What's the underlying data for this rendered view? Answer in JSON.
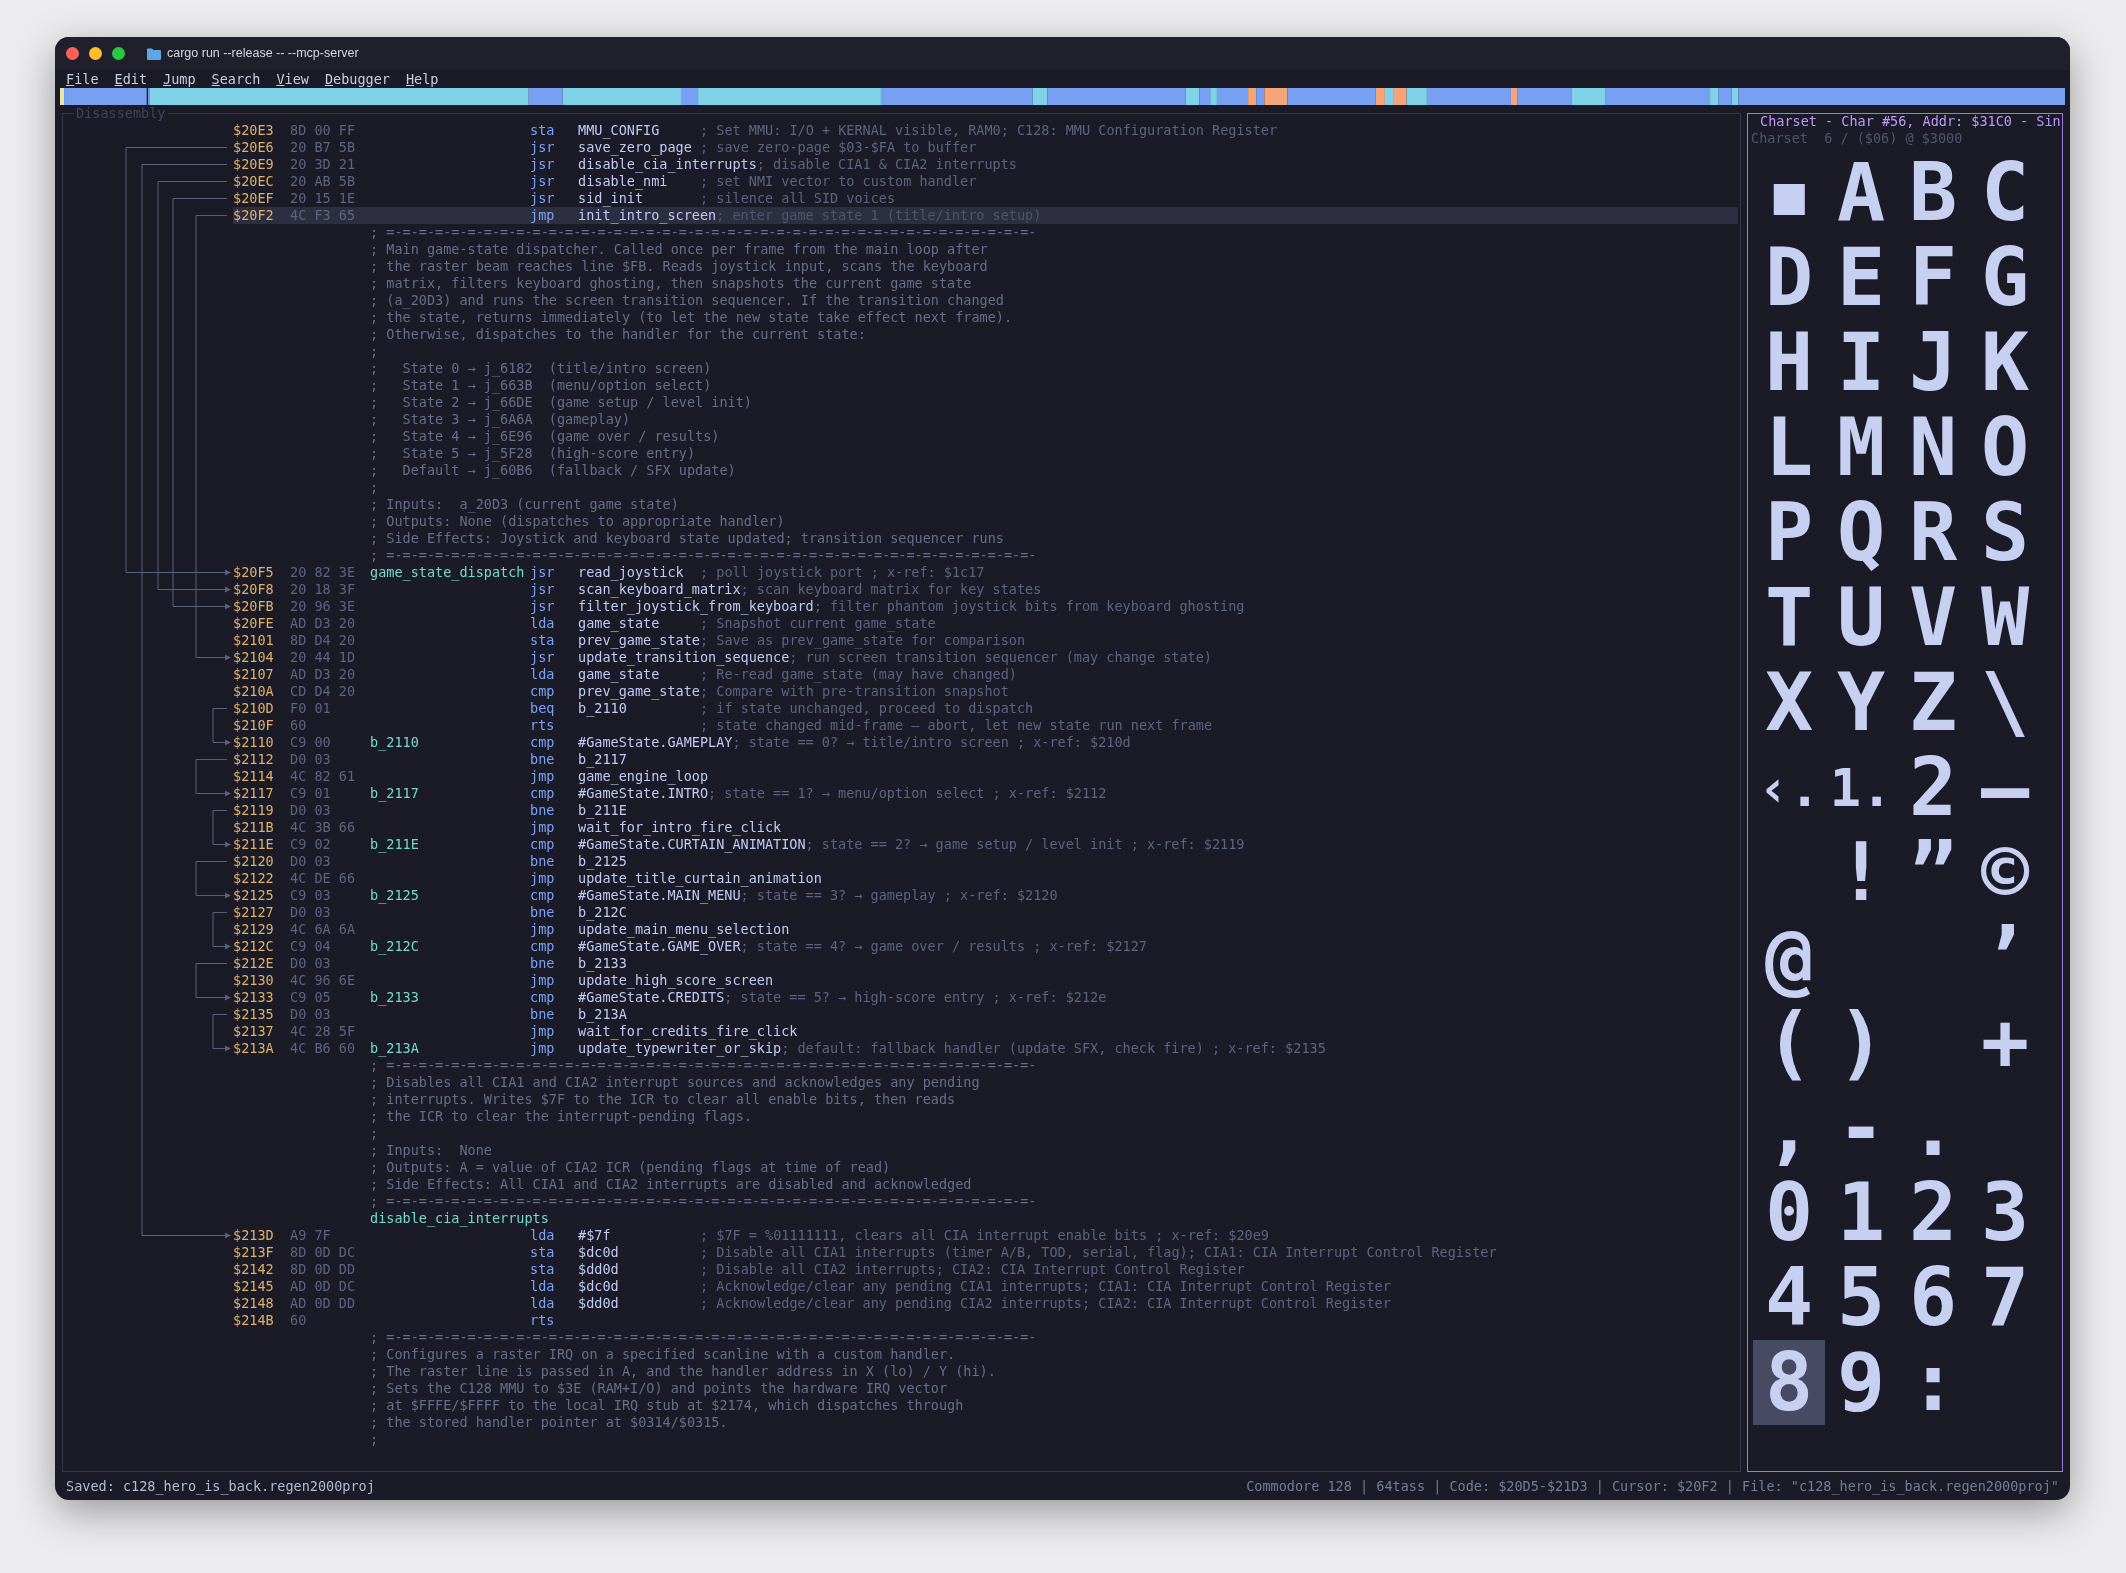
{
  "window": {
    "title": "cargo run --release -- --mcp-server"
  },
  "menu": [
    "File",
    "Edit",
    "Jump",
    "Search",
    "View",
    "Debugger",
    "Help"
  ],
  "disassembly": {
    "title": "Disassembly",
    "lines": [
      {
        "kind": "code",
        "address": "$20E3",
        "bytes": "8D 00 FF",
        "mnemonic": "sta",
        "operand": "MMU_CONFIG",
        "comment": "; Set MMU: I/O + KERNAL visible, RAM0; C128: MMU Configuration Register",
        "selected": false
      },
      {
        "kind": "code",
        "address": "$20E6",
        "bytes": "20 B7 5B",
        "mnemonic": "jsr",
        "operand": "save_zero_page",
        "comment": "; save zero-page $03-$FA to buffer",
        "selected": false
      },
      {
        "kind": "code",
        "address": "$20E9",
        "bytes": "20 3D 21",
        "mnemonic": "jsr",
        "operand": "disable_cia_interrupts",
        "comment": "; disable CIA1 & CIA2 interrupts",
        "selected": false
      },
      {
        "kind": "code",
        "address": "$20EC",
        "bytes": "20 AB 5B",
        "mnemonic": "jsr",
        "operand": "disable_nmi",
        "comment": "; set NMI vector to custom handler",
        "selected": false
      },
      {
        "kind": "code",
        "address": "$20EF",
        "bytes": "20 15 1E",
        "mnemonic": "jsr",
        "operand": "sid_init",
        "comment": "; silence all SID voices",
        "selected": false
      },
      {
        "kind": "code",
        "address": "$20F2",
        "bytes": "4C F3 65",
        "mnemonic": "jmp",
        "operand": "init_intro_screen",
        "comment": "; enter game state 1 (title/intro setup)",
        "selected": true
      },
      {
        "kind": "comment",
        "text": "; =-=-=-=-=-=-=-=-=-=-=-=-=-=-=-=-=-=-=-=-=-=-=-=-=-=-=-=-=-=-=-=-=-=-=-=-=-=-=-=-",
        "selected": false
      },
      {
        "kind": "comment",
        "text": "; Main game-state dispatcher. Called once per frame from the main loop after",
        "selected": false
      },
      {
        "kind": "comment",
        "text": "; the raster beam reaches line $FB. Reads joystick input, scans the keyboard",
        "selected": false
      },
      {
        "kind": "comment",
        "text": "; matrix, filters keyboard ghosting, then snapshots the current game state",
        "selected": false
      },
      {
        "kind": "comment",
        "text": "; (a_20D3) and runs the screen transition sequencer. If the transition changed",
        "selected": false
      },
      {
        "kind": "comment",
        "text": "; the state, returns immediately (to let the new state take effect next frame).",
        "selected": false
      },
      {
        "kind": "comment",
        "text": "; Otherwise, dispatches to the handler for the current state:",
        "selected": false
      },
      {
        "kind": "comment",
        "text": ";",
        "selected": false
      },
      {
        "kind": "comment",
        "text": ";   State 0 → j_6182  (title/intro screen)",
        "selected": false
      },
      {
        "kind": "comment",
        "text": ";   State 1 → j_663B  (menu/option select)",
        "selected": false
      },
      {
        "kind": "comment",
        "text": ";   State 2 → j_66DE  (game setup / level init)",
        "selected": false
      },
      {
        "kind": "comment",
        "text": ";   State 3 → j_6A6A  (gameplay)",
        "selected": false
      },
      {
        "kind": "comment",
        "text": ";   State 4 → j_6E96  (game over / results)",
        "selected": false
      },
      {
        "kind": "comment",
        "text": ";   State 5 → j_5F28  (high-score entry)",
        "selected": false
      },
      {
        "kind": "comment",
        "text": ";   Default → j_60B6  (fallback / SFX update)",
        "selected": false
      },
      {
        "kind": "comment",
        "text": ";",
        "selected": false
      },
      {
        "kind": "comment",
        "text": "; Inputs:  a_20D3 (current game state)",
        "selected": false
      },
      {
        "kind": "comment",
        "text": "; Outputs: None (dispatches to appropriate handler)",
        "selected": false
      },
      {
        "kind": "comment",
        "text": "; Side Effects: Joystick and keyboard state updated; transition sequencer runs",
        "selected": false
      },
      {
        "kind": "comment",
        "text": "; =-=-=-=-=-=-=-=-=-=-=-=-=-=-=-=-=-=-=-=-=-=-=-=-=-=-=-=-=-=-=-=-=-=-=-=-=-=-=-=-",
        "selected": false
      },
      {
        "kind": "code",
        "address": "$20F5",
        "bytes": "20 82 3E",
        "label": "game_state_dispatch",
        "mnemonic": "jsr",
        "operand": "read_joystick",
        "comment": "; poll joystick port ; x-ref: $1c17",
        "selected": false
      },
      {
        "kind": "code",
        "address": "$20F8",
        "bytes": "20 18 3F",
        "mnemonic": "jsr",
        "operand": "scan_keyboard_matrix",
        "comment": "; scan keyboard matrix for key states",
        "selected": false
      },
      {
        "kind": "code",
        "address": "$20FB",
        "bytes": "20 96 3E",
        "mnemonic": "jsr",
        "operand": "filter_joystick_from_keyboard",
        "comment": "; filter phantom joystick bits from keyboard ghosting",
        "selected": false
      },
      {
        "kind": "code",
        "address": "$20FE",
        "bytes": "AD D3 20",
        "mnemonic": "lda",
        "operand": "game_state",
        "comment": "; Snapshot current game_state",
        "selected": false
      },
      {
        "kind": "code",
        "address": "$2101",
        "bytes": "8D D4 20",
        "mnemonic": "sta",
        "operand": "prev_game_state",
        "comment": "; Save as prev_game_state for comparison",
        "selected": false
      },
      {
        "kind": "code",
        "address": "$2104",
        "bytes": "20 44 1D",
        "mnemonic": "jsr",
        "operand": "update_transition_sequence",
        "comment": "; run screen transition sequencer (may change state)",
        "selected": false
      },
      {
        "kind": "code",
        "address": "$2107",
        "bytes": "AD D3 20",
        "mnemonic": "lda",
        "operand": "game_state",
        "comment": "; Re-read game_state (may have changed)",
        "selected": false
      },
      {
        "kind": "code",
        "address": "$210A",
        "bytes": "CD D4 20",
        "mnemonic": "cmp",
        "operand": "prev_game_state",
        "comment": "; Compare with pre-transition snapshot",
        "selected": false
      },
      {
        "kind": "code",
        "address": "$210D",
        "bytes": "F0 01",
        "mnemonic": "beq",
        "operand": "b_2110",
        "comment": "; if state unchanged, proceed to dispatch",
        "selected": false
      },
      {
        "kind": "code",
        "address": "$210F",
        "bytes": "60",
        "mnemonic": "rts",
        "comment": "; state changed mid-frame — abort, let new state run next frame",
        "selected": false
      },
      {
        "kind": "code",
        "address": "$2110",
        "bytes": "C9 00",
        "label": "b_2110",
        "mnemonic": "cmp",
        "operand": "#GameState.GAMEPLAY",
        "comment": "; state == 0? → title/intro screen ; x-ref: $210d",
        "selected": false
      },
      {
        "kind": "code",
        "address": "$2112",
        "bytes": "D0 03",
        "mnemonic": "bne",
        "operand": "b_2117",
        "selected": false
      },
      {
        "kind": "code",
        "address": "$2114",
        "bytes": "4C 82 61",
        "mnemonic": "jmp",
        "operand": "game_engine_loop",
        "selected": false
      },
      {
        "kind": "code",
        "address": "$2117",
        "bytes": "C9 01",
        "label": "b_2117",
        "mnemonic": "cmp",
        "operand": "#GameState.INTRO",
        "comment": "; state == 1? → menu/option select ; x-ref: $2112",
        "selected": false
      },
      {
        "kind": "code",
        "address": "$2119",
        "bytes": "D0 03",
        "mnemonic": "bne",
        "operand": "b_211E",
        "selected": false
      },
      {
        "kind": "code",
        "address": "$211B",
        "bytes": "4C 3B 66",
        "mnemonic": "jmp",
        "operand": "wait_for_intro_fire_click",
        "selected": false
      },
      {
        "kind": "code",
        "address": "$211E",
        "bytes": "C9 02",
        "label": "b_211E",
        "mnemonic": "cmp",
        "operand": "#GameState.CURTAIN_ANIMATION",
        "comment": "; state == 2? → game setup / level init ; x-ref: $2119",
        "selected": false
      },
      {
        "kind": "code",
        "address": "$2120",
        "bytes": "D0 03",
        "mnemonic": "bne",
        "operand": "b_2125",
        "selected": false
      },
      {
        "kind": "code",
        "address": "$2122",
        "bytes": "4C DE 66",
        "mnemonic": "jmp",
        "operand": "update_title_curtain_animation",
        "selected": false
      },
      {
        "kind": "code",
        "address": "$2125",
        "bytes": "C9 03",
        "label": "b_2125",
        "mnemonic": "cmp",
        "operand": "#GameState.MAIN_MENU",
        "comment": "; state == 3? → gameplay ; x-ref: $2120",
        "selected": false
      },
      {
        "kind": "code",
        "address": "$2127",
        "bytes": "D0 03",
        "mnemonic": "bne",
        "operand": "b_212C",
        "selected": false
      },
      {
        "kind": "code",
        "address": "$2129",
        "bytes": "4C 6A 6A",
        "mnemonic": "jmp",
        "operand": "update_main_menu_selection",
        "selected": false
      },
      {
        "kind": "code",
        "address": "$212C",
        "bytes": "C9 04",
        "label": "b_212C",
        "mnemonic": "cmp",
        "operand": "#GameState.GAME_OVER",
        "comment": "; state == 4? → game over / results ; x-ref: $2127",
        "selected": false
      },
      {
        "kind": "code",
        "address": "$212E",
        "bytes": "D0 03",
        "mnemonic": "bne",
        "operand": "b_2133",
        "selected": false
      },
      {
        "kind": "code",
        "address": "$2130",
        "bytes": "4C 96 6E",
        "mnemonic": "jmp",
        "operand": "update_high_score_screen",
        "selected": false
      },
      {
        "kind": "code",
        "address": "$2133",
        "bytes": "C9 05",
        "label": "b_2133",
        "mnemonic": "cmp",
        "operand": "#GameState.CREDITS",
        "comment": "; state == 5? → high-score entry ; x-ref: $212e",
        "selected": false
      },
      {
        "kind": "code",
        "address": "$2135",
        "bytes": "D0 03",
        "mnemonic": "bne",
        "operand": "b_213A",
        "selected": false
      },
      {
        "kind": "code",
        "address": "$2137",
        "bytes": "4C 28 5F",
        "mnemonic": "jmp",
        "operand": "wait_for_credits_fire_click",
        "selected": false
      },
      {
        "kind": "code",
        "address": "$213A",
        "bytes": "4C B6 60",
        "label": "b_213A",
        "mnemonic": "jmp",
        "operand": "update_typewriter_or_skip",
        "comment": "; default: fallback handler (update SFX, check fire) ; x-ref: $2135",
        "selected": false
      },
      {
        "kind": "comment",
        "text": "; =-=-=-=-=-=-=-=-=-=-=-=-=-=-=-=-=-=-=-=-=-=-=-=-=-=-=-=-=-=-=-=-=-=-=-=-=-=-=-=-",
        "selected": false
      },
      {
        "kind": "comment",
        "text": "; Disables all CIA1 and CIA2 interrupt sources and acknowledges any pending",
        "selected": false
      },
      {
        "kind": "comment",
        "text": "; interrupts. Writes $7F to the ICR to clear all enable bits, then reads",
        "selected": false
      },
      {
        "kind": "comment",
        "text": "; the ICR to clear the interrupt-pending flags.",
        "selected": false
      },
      {
        "kind": "comment",
        "text": ";",
        "selected": false
      },
      {
        "kind": "comment",
        "text": "; Inputs:  None",
        "selected": false
      },
      {
        "kind": "comment",
        "text": "; Outputs: A = value of CIA2 ICR (pending flags at time of read)",
        "selected": false
      },
      {
        "kind": "comment",
        "text": "; Side Effects: All CIA1 and CIA2 interrupts are disabled and acknowledged",
        "selected": false
      },
      {
        "kind": "comment",
        "text": "; =-=-=-=-=-=-=-=-=-=-=-=-=-=-=-=-=-=-=-=-=-=-=-=-=-=-=-=-=-=-=-=-=-=-=-=-=-=-=-=-",
        "selected": false
      },
      {
        "kind": "label",
        "label": "disable_cia_interrupts",
        "selected": false
      },
      {
        "kind": "code",
        "address": "$213D",
        "bytes": "A9 7F",
        "mnemonic": "lda",
        "operand": "#$7f",
        "comment": "; $7F = %01111111, clears all CIA interrupt enable bits ; x-ref: $20e9",
        "selected": false
      },
      {
        "kind": "code",
        "address": "$213F",
        "bytes": "8D 0D DC",
        "mnemonic": "sta",
        "operand": "$dc0d",
        "comment": "; Disable all CIA1 interrupts (timer A/B, TOD, serial, flag); CIA1: CIA Interrupt Control Register",
        "selected": false
      },
      {
        "kind": "code",
        "address": "$2142",
        "bytes": "8D 0D DD",
        "mnemonic": "sta",
        "operand": "$dd0d",
        "comment": "; Disable all CIA2 interrupts; CIA2: CIA Interrupt Control Register",
        "selected": false
      },
      {
        "kind": "code",
        "address": "$2145",
        "bytes": "AD 0D DC",
        "mnemonic": "lda",
        "operand": "$dc0d",
        "comment": "; Acknowledge/clear any pending CIA1 interrupts; CIA1: CIA Interrupt Control Register",
        "selected": false
      },
      {
        "kind": "code",
        "address": "$2148",
        "bytes": "AD 0D DD",
        "mnemonic": "lda",
        "operand": "$dd0d",
        "comment": "; Acknowledge/clear any pending CIA2 interrupts; CIA2: CIA Interrupt Control Register",
        "selected": false
      },
      {
        "kind": "code",
        "address": "$214B",
        "bytes": "60",
        "mnemonic": "rts",
        "selected": false
      },
      {
        "kind": "comment",
        "text": "; =-=-=-=-=-=-=-=-=-=-=-=-=-=-=-=-=-=-=-=-=-=-=-=-=-=-=-=-=-=-=-=-=-=-=-=-=-=-=-=-",
        "selected": false
      },
      {
        "kind": "comment",
        "text": "; Configures a raster IRQ on a specified scanline with a custom handler.",
        "selected": false
      },
      {
        "kind": "comment",
        "text": "; The raster line is passed in A, and the handler address in X (lo) / Y (hi).",
        "selected": false
      },
      {
        "kind": "comment",
        "text": "; Sets the C128 MMU to $3E (RAM+I/O) and points the hardware IRQ vector",
        "selected": false
      },
      {
        "kind": "comment",
        "text": "; at $FFFE/$FFFF to the local IRQ stub at $2174, which dispatches through",
        "selected": false
      },
      {
        "kind": "comment",
        "text": "; the stored handler pointer at $0314/$0315.",
        "selected": false
      },
      {
        "kind": "comment",
        "text": ";",
        "selected": false
      }
    ]
  },
  "charset": {
    "title": "Charset - Char #56, Addr: $31C0 - Sin",
    "subtitle": "Charset  6 / ($06) @ $3000",
    "glyphs": [
      {
        "kind": "glyph",
        "char": "▪",
        "selected": false
      },
      {
        "kind": "glyph",
        "char": "A",
        "selected": false
      },
      {
        "kind": "glyph",
        "char": "B",
        "selected": false
      },
      {
        "kind": "glyph",
        "char": "C",
        "selected": false
      },
      {
        "kind": "glyph",
        "char": "D",
        "selected": false
      },
      {
        "kind": "glyph",
        "char": "E",
        "selected": false
      },
      {
        "kind": "glyph",
        "char": "F",
        "selected": false
      },
      {
        "kind": "glyph",
        "char": "G",
        "selected": false
      },
      {
        "kind": "glyph",
        "char": "H",
        "selected": false
      },
      {
        "kind": "glyph",
        "char": "I",
        "selected": false
      },
      {
        "kind": "glyph",
        "char": "J",
        "selected": false
      },
      {
        "kind": "glyph",
        "char": "K",
        "selected": false
      },
      {
        "kind": "glyph",
        "char": "L",
        "selected": false
      },
      {
        "kind": "glyph",
        "char": "M",
        "selected": false
      },
      {
        "kind": "glyph",
        "char": "N",
        "selected": false
      },
      {
        "kind": "glyph",
        "char": "O",
        "selected": false
      },
      {
        "kind": "glyph",
        "char": "P",
        "selected": false
      },
      {
        "kind": "glyph",
        "char": "Q",
        "selected": false
      },
      {
        "kind": "glyph",
        "char": "R",
        "selected": false
      },
      {
        "kind": "glyph",
        "char": "S",
        "selected": false
      },
      {
        "kind": "glyph",
        "char": "T",
        "selected": false
      },
      {
        "kind": "glyph",
        "char": "U",
        "selected": false
      },
      {
        "kind": "glyph",
        "char": "V",
        "selected": false
      },
      {
        "kind": "glyph",
        "char": "W",
        "selected": false
      },
      {
        "kind": "glyph",
        "char": "X",
        "selected": false
      },
      {
        "kind": "glyph",
        "char": "Y",
        "selected": false
      },
      {
        "kind": "glyph",
        "char": "Z",
        "selected": false
      },
      {
        "kind": "glyph",
        "char": "\\",
        "selected": false
      },
      {
        "kind": "glyph",
        "char": "‹.",
        "selected": false
      },
      {
        "kind": "glyph",
        "char": "1.",
        "selected": false
      },
      {
        "kind": "glyph",
        "char": "2",
        "selected": false
      },
      {
        "kind": "glyph",
        "char": "—",
        "selected": false
      },
      {
        "kind": "blank"
      },
      {
        "kind": "glyph",
        "char": "!",
        "selected": false
      },
      {
        "kind": "glyph",
        "char": "”",
        "selected": false
      },
      {
        "kind": "glyph",
        "char": "©",
        "selected": false
      },
      {
        "kind": "glyph",
        "char": "@",
        "selected": false
      },
      {
        "kind": "blank"
      },
      {
        "kind": "blank"
      },
      {
        "kind": "glyph",
        "char": "’",
        "selected": false
      },
      {
        "kind": "glyph",
        "char": "(",
        "selected": false
      },
      {
        "kind": "glyph",
        "char": ")",
        "selected": false
      },
      {
        "kind": "blank"
      },
      {
        "kind": "glyph",
        "char": "+",
        "selected": false
      },
      {
        "kind": "glyph",
        "char": ",",
        "selected": false
      },
      {
        "kind": "glyph",
        "char": "-",
        "selected": false
      },
      {
        "kind": "glyph",
        "char": ".",
        "selected": false
      },
      {
        "kind": "blank"
      },
      {
        "kind": "glyph",
        "char": "0",
        "selected": false
      },
      {
        "kind": "glyph",
        "char": "1",
        "selected": false
      },
      {
        "kind": "glyph",
        "char": "2",
        "selected": false
      },
      {
        "kind": "glyph",
        "char": "3",
        "selected": false
      },
      {
        "kind": "glyph",
        "char": "4",
        "selected": false
      },
      {
        "kind": "glyph",
        "char": "5",
        "selected": false
      },
      {
        "kind": "glyph",
        "char": "6",
        "selected": false
      },
      {
        "kind": "glyph",
        "char": "7",
        "selected": false
      },
      {
        "kind": "glyph",
        "char": "8",
        "selected": true
      },
      {
        "kind": "glyph",
        "char": "9",
        "selected": false
      },
      {
        "kind": "glyph",
        "char": ":",
        "selected": false
      }
    ]
  },
  "status_bar": {
    "left": "Saved: c128_hero_is_back.regen2000proj",
    "right": "Commodore 128 | 64tass | Code: $20D5-$21D3 | Cursor: $20F2 | File: \"c128_hero_is_back.regen2000proj\""
  }
}
